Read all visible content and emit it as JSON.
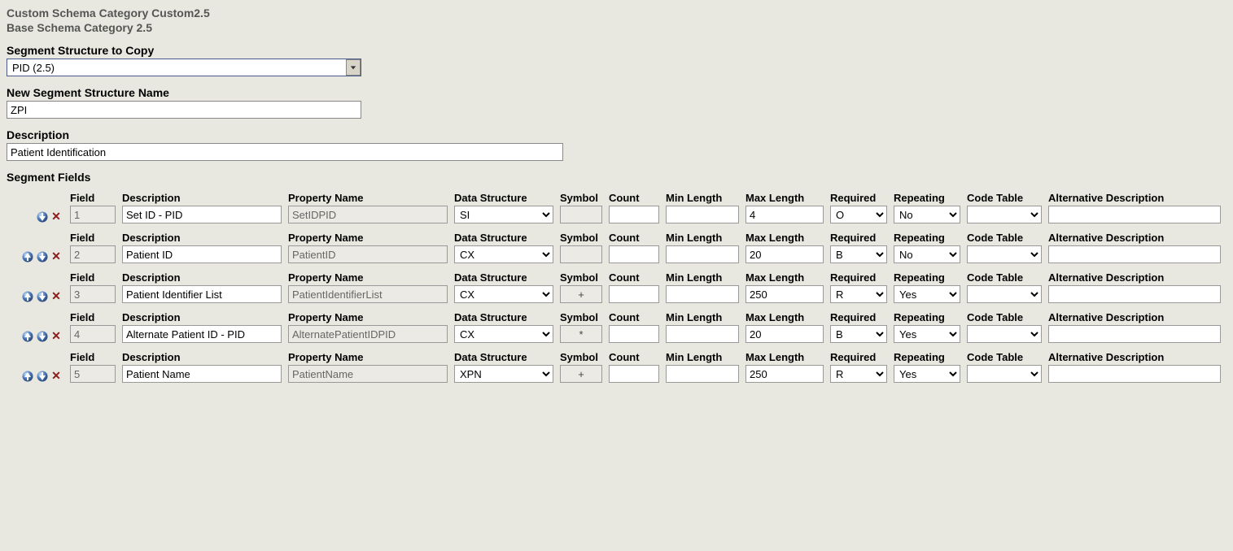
{
  "header": {
    "custom_line": "Custom Schema Category Custom2.5",
    "base_line": "Base Schema Category 2.5"
  },
  "labels": {
    "segment_to_copy": "Segment Structure to Copy",
    "new_name": "New Segment Structure Name",
    "description": "Description",
    "segment_fields": "Segment Fields"
  },
  "inputs": {
    "segment_to_copy_value": "PID (2.5)",
    "new_name_value": "ZPI",
    "description_value": "Patient Identification"
  },
  "column_headers": {
    "field": "Field",
    "description": "Description",
    "property": "Property Name",
    "data_structure": "Data Structure",
    "symbol": "Symbol",
    "count": "Count",
    "min_len": "Min Length",
    "max_len": "Max Length",
    "required": "Required",
    "repeating": "Repeating",
    "code_table": "Code Table",
    "alt_desc": "Alternative Description"
  },
  "rows": [
    {
      "show_up": false,
      "show_down": true,
      "field": "1",
      "description": "Set ID - PID",
      "property": "SetIDPID",
      "data_structure": "SI",
      "symbol": "",
      "count": "",
      "min_len": "",
      "max_len": "4",
      "required": "O",
      "repeating": "No",
      "code_table": "",
      "alt_desc": ""
    },
    {
      "show_up": true,
      "show_down": true,
      "field": "2",
      "description": "Patient ID",
      "property": "PatientID",
      "data_structure": "CX",
      "symbol": "",
      "count": "",
      "min_len": "",
      "max_len": "20",
      "required": "B",
      "repeating": "No",
      "code_table": "",
      "alt_desc": ""
    },
    {
      "show_up": true,
      "show_down": true,
      "field": "3",
      "description": "Patient Identifier List",
      "property": "PatientIdentifierList",
      "data_structure": "CX",
      "symbol": "+",
      "count": "",
      "min_len": "",
      "max_len": "250",
      "required": "R",
      "repeating": "Yes",
      "code_table": "",
      "alt_desc": ""
    },
    {
      "show_up": true,
      "show_down": true,
      "field": "4",
      "description": "Alternate Patient ID - PID",
      "property": "AlternatePatientIDPID",
      "data_structure": "CX",
      "symbol": "*",
      "count": "",
      "min_len": "",
      "max_len": "20",
      "required": "B",
      "repeating": "Yes",
      "code_table": "",
      "alt_desc": ""
    },
    {
      "show_up": true,
      "show_down": true,
      "field": "5",
      "description": "Patient Name",
      "property": "PatientName",
      "data_structure": "XPN",
      "symbol": "+",
      "count": "",
      "min_len": "",
      "max_len": "250",
      "required": "R",
      "repeating": "Yes",
      "code_table": "",
      "alt_desc": ""
    }
  ]
}
